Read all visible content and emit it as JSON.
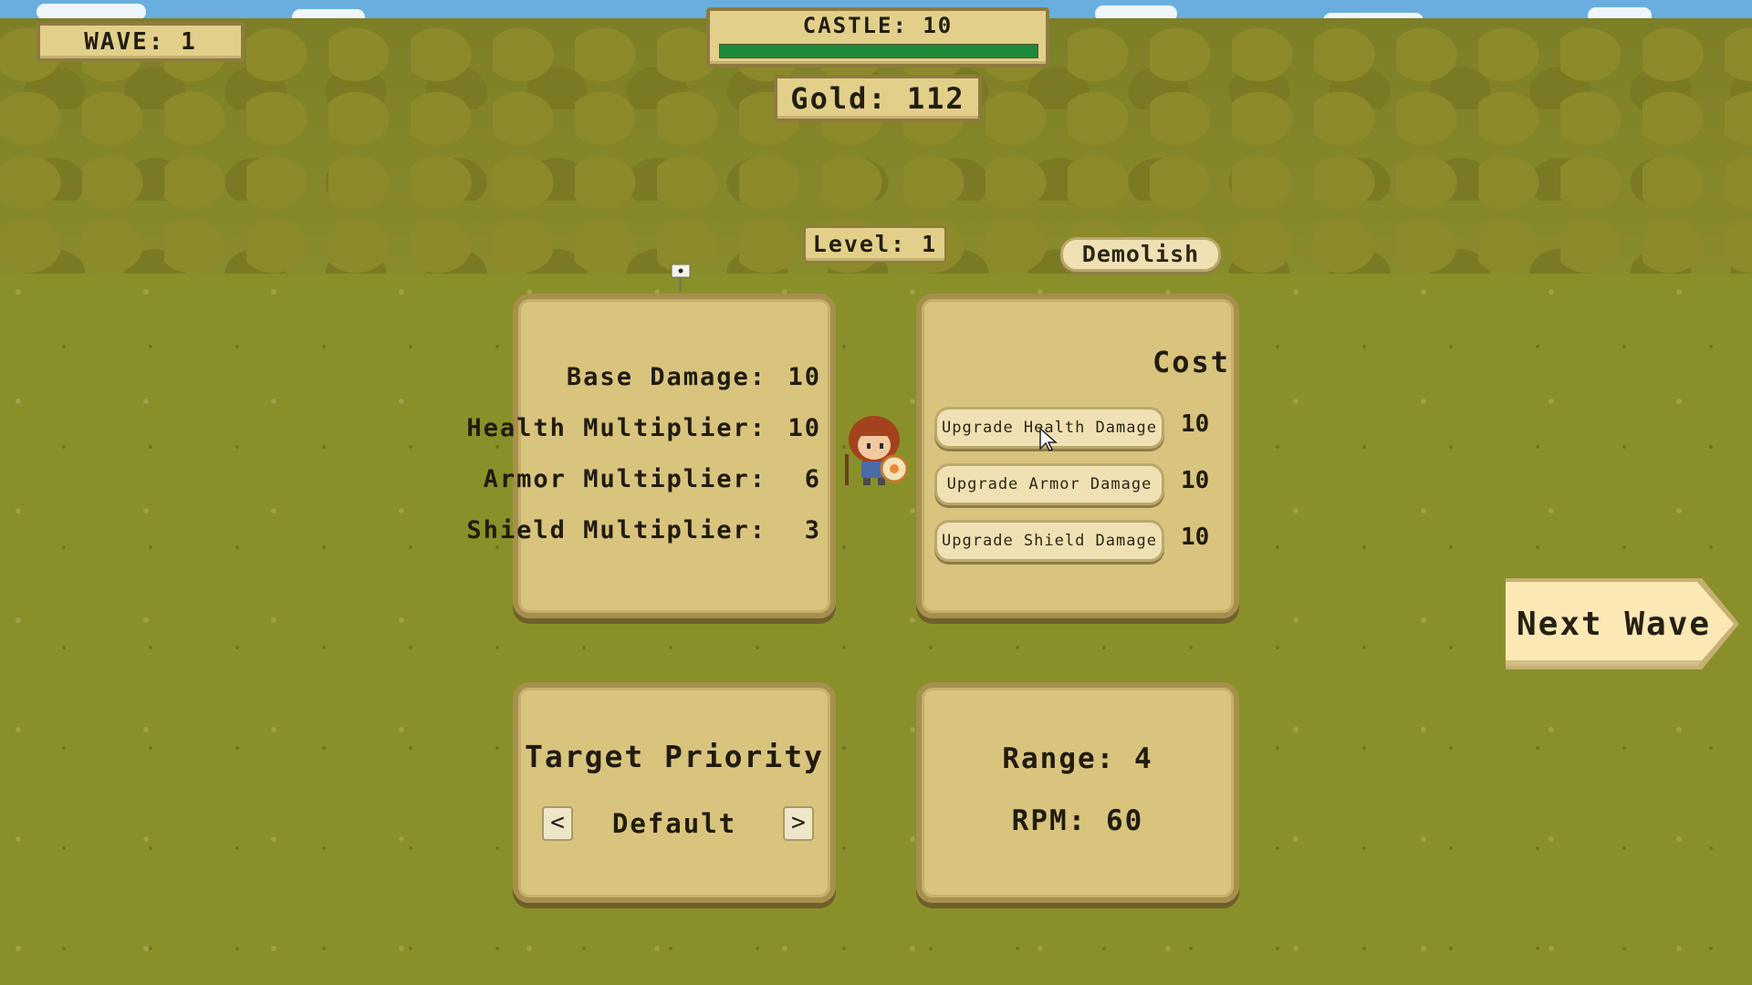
{
  "hud": {
    "wave_label": "WAVE: 1",
    "castle_label": "CASTLE: 10",
    "castle_health_fraction": 1.0,
    "gold_label": "Gold: 112"
  },
  "tower": {
    "level_label": "Level: 1",
    "demolish_label": "Demolish"
  },
  "stats_panel": {
    "rows": [
      {
        "label": "Base Damage:",
        "value": "10"
      },
      {
        "label": "Health Multiplier:",
        "value": "10"
      },
      {
        "label": "Armor Multiplier:",
        "value": "6"
      },
      {
        "label": "Shield Multiplier:",
        "value": "3"
      }
    ]
  },
  "upgrade_panel": {
    "cost_header": "Cost",
    "upgrades": [
      {
        "label": "Upgrade Health Damage",
        "cost": "10"
      },
      {
        "label": "Upgrade Armor Damage",
        "cost": "10"
      },
      {
        "label": "Upgrade Shield Damage",
        "cost": "10"
      }
    ]
  },
  "target_panel": {
    "title": "Target Priority",
    "prev_label": "<",
    "value": "Default",
    "next_label": ">"
  },
  "range_panel": {
    "range_label": "Range: 4",
    "rpm_label": "RPM: 60"
  },
  "next_wave_label": "Next Wave",
  "icons": [
    "flag-icon",
    "cursor-icon",
    "tower-hero-icon"
  ],
  "colors": {
    "panel": "#d9c47e",
    "panel_border": "#a78f4d",
    "health_bar": "#1d8a3a",
    "grass": "#899029"
  }
}
